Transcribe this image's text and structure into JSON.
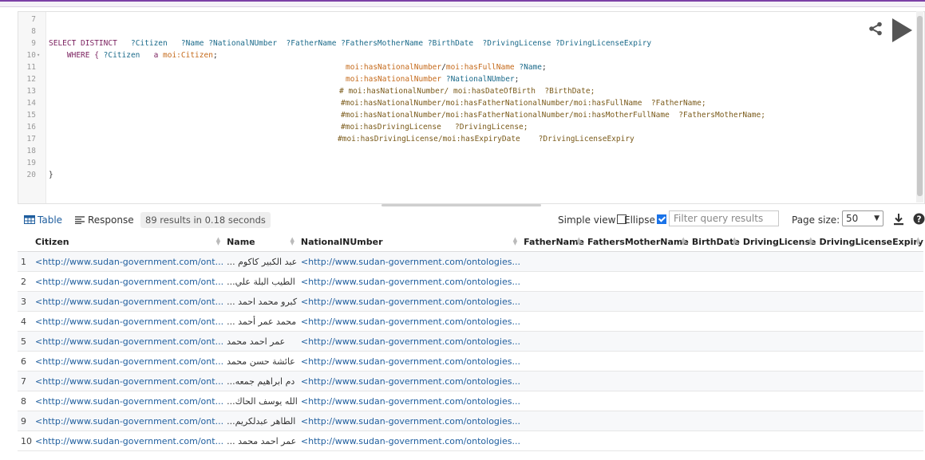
{
  "colors": {
    "accent": "#7b3fa6",
    "link": "#1f5e9e",
    "keyword": "#7a1f5e",
    "variable": "#1b6a8a",
    "prefix": "#c56a1b"
  },
  "editor": {
    "lines": [
      {
        "num": "7",
        "segments": []
      },
      {
        "num": "8",
        "segments": []
      },
      {
        "num": "9",
        "segments": [
          {
            "t": "SELECT DISTINCT",
            "c": "kw"
          },
          {
            "t": "   ",
            "c": "plain"
          },
          {
            "t": "?Citizen",
            "c": "var"
          },
          {
            "t": "   ",
            "c": "plain"
          },
          {
            "t": "?Name",
            "c": "var"
          },
          {
            "t": " ",
            "c": "plain"
          },
          {
            "t": "?NationalNUmber",
            "c": "var"
          },
          {
            "t": "  ",
            "c": "plain"
          },
          {
            "t": "?FatherName",
            "c": "var"
          },
          {
            "t": " ",
            "c": "plain"
          },
          {
            "t": "?FathersMotherName",
            "c": "var"
          },
          {
            "t": " ",
            "c": "plain"
          },
          {
            "t": "?BirthDate",
            "c": "var"
          },
          {
            "t": "  ",
            "c": "plain"
          },
          {
            "t": "?DrivingLicense",
            "c": "var"
          },
          {
            "t": " ",
            "c": "plain"
          },
          {
            "t": "?DrivingLicenseExpiry",
            "c": "var"
          }
        ]
      },
      {
        "num": "10",
        "fold": true,
        "segments": [
          {
            "t": "    WHERE { ",
            "c": "kw"
          },
          {
            "t": "?Citizen",
            "c": "var"
          },
          {
            "t": "   a ",
            "c": "kw"
          },
          {
            "t": "moi:Citizen",
            "c": "pfx"
          },
          {
            "t": ";",
            "c": "plain"
          }
        ]
      },
      {
        "num": "11",
        "segments": [
          {
            "t": "moi:hasNationalNumber",
            "c": "pfx"
          },
          {
            "t": "/",
            "c": "plain"
          },
          {
            "t": "moi:hasFullName",
            "c": "pfx"
          },
          {
            "t": " ",
            "c": "plain"
          },
          {
            "t": "?Name",
            "c": "var"
          },
          {
            "t": ";",
            "c": "plain"
          }
        ]
      },
      {
        "num": "12",
        "segments": [
          {
            "t": "moi:hasNationalNumber",
            "c": "pfx"
          },
          {
            "t": " ",
            "c": "plain"
          },
          {
            "t": "?NationalNUmber",
            "c": "var"
          },
          {
            "t": ";",
            "c": "plain"
          }
        ]
      },
      {
        "num": "13",
        "segments": [
          {
            "t": "# moi:hasNationalNumber/ moi:hasDateOfBirth  ?BirthDate;",
            "c": "cmt"
          }
        ]
      },
      {
        "num": "14",
        "segments": [
          {
            "t": "#moi:hasNationalNumber/moi:hasFatherNationalNumber/moi:hasFullName  ?FatherName;",
            "c": "cmt"
          }
        ]
      },
      {
        "num": "15",
        "segments": [
          {
            "t": "#moi:hasNationalNumber/moi:hasFatherNationalNumber/moi:hasMotherFullName  ?FathersMotherName;",
            "c": "cmt"
          }
        ]
      },
      {
        "num": "16",
        "segments": [
          {
            "t": "#moi:hasDrivingLicense   ?DrivingLicense;",
            "c": "cmt"
          }
        ]
      },
      {
        "num": "17",
        "segments": [
          {
            "t": "#moi:hasDrivingLicense/moi:hasExpiryDate    ?DrivingLicenseExpiry",
            "c": "cmt"
          }
        ]
      },
      {
        "num": "18",
        "segments": []
      },
      {
        "num": "19",
        "segments": []
      },
      {
        "num": "20",
        "segments": [
          {
            "t": "}",
            "c": "plain"
          }
        ]
      }
    ],
    "share_icon": "share-icon",
    "run_icon": "play-icon"
  },
  "toolbar": {
    "tab_table": "Table",
    "tab_response": "Response",
    "results_summary": "89 results in 0.18 seconds",
    "simple_view_label": "Simple view",
    "simple_view_checked": false,
    "ellipse_label": "Ellipse",
    "ellipse_checked": true,
    "filter_placeholder": "Filter query results",
    "page_size_label": "Page size:",
    "page_size_value": "50"
  },
  "table": {
    "columns": [
      "Citizen",
      "Name",
      "NationalNUmber",
      "FatherName",
      "FathersMotherName",
      "BirthDate",
      "DrivingLicense",
      "DrivingLicenseExpiry"
    ],
    "rows": [
      {
        "idx": "1",
        "citizen": "<http://www.sudan-government.com/ont...",
        "name": "عبد الكبير كاكوم ...",
        "nn": "<http://www.sudan-government.com/ontologies..."
      },
      {
        "idx": "2",
        "citizen": "<http://www.sudan-government.com/ont...",
        "name": "الطيب البلة علي...",
        "nn": "<http://www.sudan-government.com/ontologies..."
      },
      {
        "idx": "3",
        "citizen": "<http://www.sudan-government.com/ont...",
        "name": "كبرو محمد احمد ...",
        "nn": "<http://www.sudan-government.com/ontologies..."
      },
      {
        "idx": "4",
        "citizen": "<http://www.sudan-government.com/ont...",
        "name": "محمد عمر أحمد ...",
        "nn": "<http://www.sudan-government.com/ontologies..."
      },
      {
        "idx": "5",
        "citizen": "<http://www.sudan-government.com/ont...",
        "name": "عمر احمد محمد",
        "nn": "<http://www.sudan-government.com/ontologies..."
      },
      {
        "idx": "6",
        "citizen": "<http://www.sudan-government.com/ont...",
        "name": "عائشة حسن محمد",
        "nn": "<http://www.sudan-government.com/ontologies..."
      },
      {
        "idx": "7",
        "citizen": "<http://www.sudan-government.com/ont...",
        "name": "دم ابراهيم جمعه...",
        "nn": "<http://www.sudan-government.com/ontologies..."
      },
      {
        "idx": "8",
        "citizen": "<http://www.sudan-government.com/ont...",
        "name": "الله يوسف الحاك...",
        "nn": "<http://www.sudan-government.com/ontologies..."
      },
      {
        "idx": "9",
        "citizen": "<http://www.sudan-government.com/ont...",
        "name": "الطاهر عبدلكريم...",
        "nn": "<http://www.sudan-government.com/ontologies..."
      },
      {
        "idx": "10",
        "citizen": "<http://www.sudan-government.com/ont...",
        "name": "عمر احمد محمد ...",
        "nn": "<http://www.sudan-government.com/ontologies..."
      }
    ]
  }
}
